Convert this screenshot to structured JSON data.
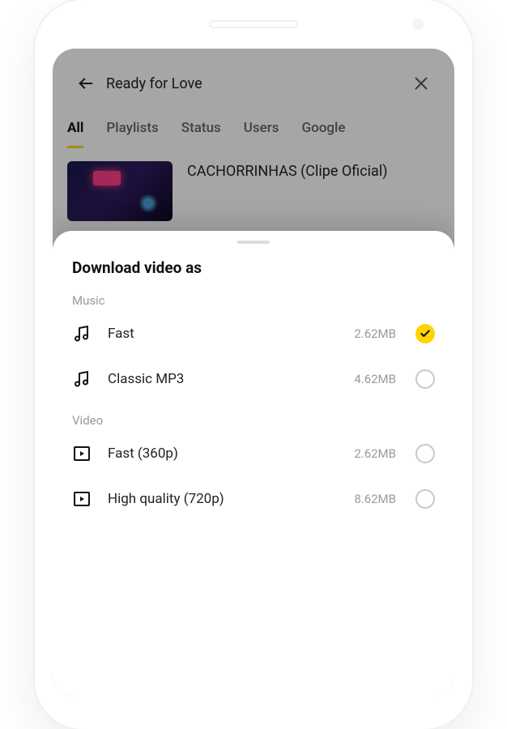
{
  "search": {
    "query": "Ready for Love"
  },
  "tabs": [
    {
      "label": "All",
      "active": true
    },
    {
      "label": "Playlists",
      "active": false
    },
    {
      "label": "Status",
      "active": false
    },
    {
      "label": "Users",
      "active": false
    },
    {
      "label": "Google",
      "active": false
    }
  ],
  "result": {
    "title": "CACHORRINHAS (Clipe Oficial)"
  },
  "sheet": {
    "title": "Download video as",
    "sections": [
      {
        "label": "Music",
        "options": [
          {
            "icon": "music",
            "label": "Fast",
            "size": "2.62MB",
            "selected": true
          },
          {
            "icon": "music",
            "label": "Classic MP3",
            "size": "4.62MB",
            "selected": false
          }
        ]
      },
      {
        "label": "Video",
        "options": [
          {
            "icon": "video",
            "label": "Fast (360p)",
            "size": "2.62MB",
            "selected": false
          },
          {
            "icon": "video",
            "label": "High quality (720p)",
            "size": "8.62MB",
            "selected": false
          }
        ]
      }
    ]
  }
}
